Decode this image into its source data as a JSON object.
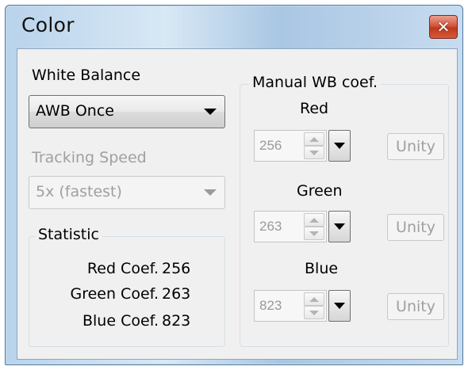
{
  "window": {
    "title": "Color",
    "close_glyph": "✕"
  },
  "white_balance": {
    "label": "White Balance",
    "mode_value": "AWB Once",
    "tracking_speed_label": "Tracking Speed",
    "tracking_speed_value": "5x (fastest)"
  },
  "statistic": {
    "title": "Statistic",
    "rows": [
      {
        "label": "Red Coef.",
        "value": "256"
      },
      {
        "label": "Green Coef.",
        "value": "263"
      },
      {
        "label": "Blue Coef.",
        "value": "823"
      }
    ]
  },
  "manual": {
    "title": "Manual WB coef.",
    "channels": [
      {
        "label": "Red",
        "value": "256",
        "unity_label": "Unity"
      },
      {
        "label": "Green",
        "value": "263",
        "unity_label": "Unity"
      },
      {
        "label": "Blue",
        "value": "823",
        "unity_label": "Unity"
      }
    ]
  },
  "icons": {
    "close": "close-icon",
    "dropdown": "chevron-down-icon",
    "spin_up": "spin-up-icon",
    "spin_down": "spin-down-icon"
  },
  "colors": {
    "titlebar": "#b9d3ec",
    "close_button": "#c7432a",
    "dialog_bg": "#f0f0f0",
    "disabled_text": "#a0a0a0"
  }
}
